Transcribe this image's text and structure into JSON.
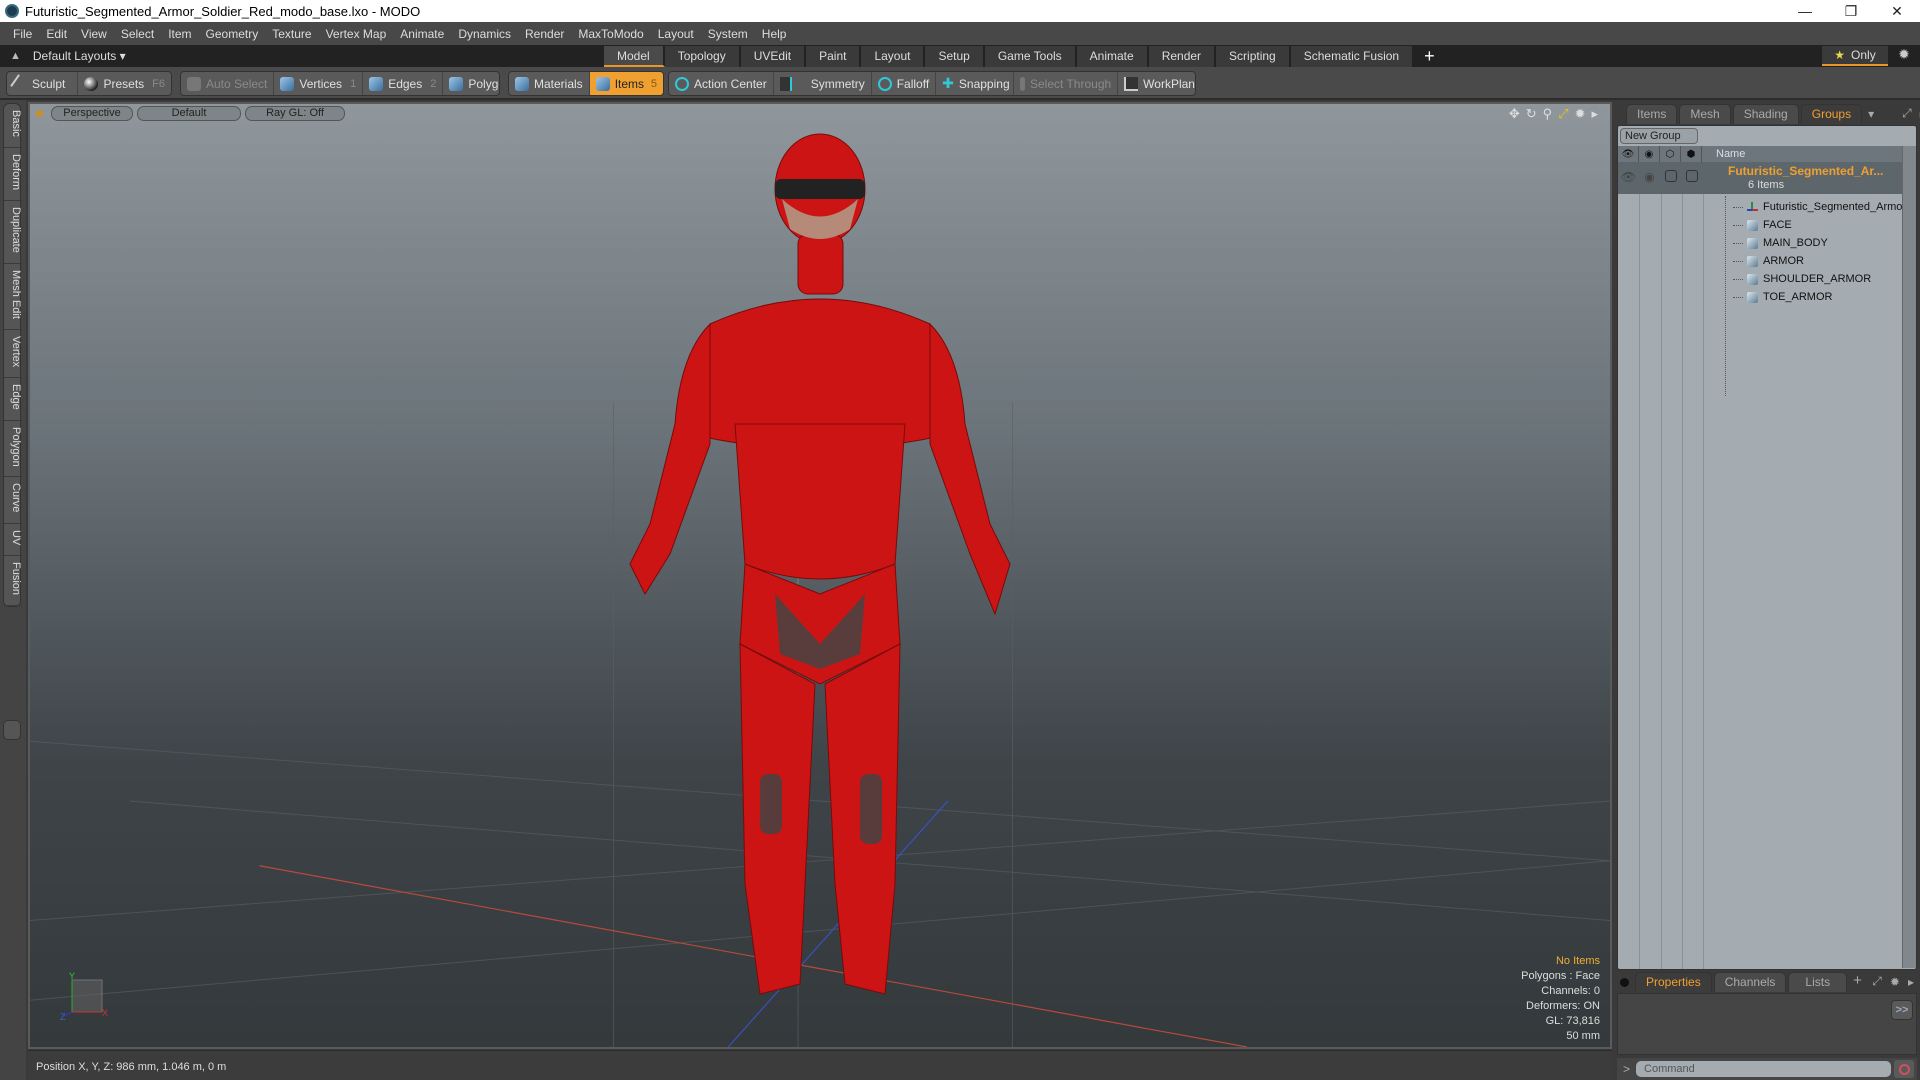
{
  "window": {
    "title": "Futuristic_Segmented_Armor_Soldier_Red_modo_base.lxo - MODO",
    "controls": {
      "minimize": "—",
      "maximize": "❐",
      "close": "✕"
    }
  },
  "menu": [
    "File",
    "Edit",
    "View",
    "Select",
    "Item",
    "Geometry",
    "Texture",
    "Vertex Map",
    "Animate",
    "Dynamics",
    "Render",
    "MaxToModo",
    "Layout",
    "System",
    "Help"
  ],
  "layoutbar": {
    "layouts_label": "Default Layouts ▾",
    "tabs": [
      "Model",
      "Topology",
      "UVEdit",
      "Paint",
      "Layout",
      "Setup",
      "Game Tools",
      "Animate",
      "Render",
      "Scripting",
      "Schematic Fusion"
    ],
    "active_tab": "Model",
    "add_tab": "+",
    "only_label": "Only"
  },
  "toolbar": {
    "sculpt": "Sculpt",
    "presets": "Presets",
    "presets_key": "F6",
    "auto_select": "Auto Select",
    "vertices": "Vertices",
    "vertices_key": "1",
    "edges": "Edges",
    "edges_key": "2",
    "polygons": "Polygons",
    "materials": "Materials",
    "items": "Items",
    "items_key": "5",
    "action_center": "Action Center",
    "symmetry": "Symmetry",
    "falloff": "Falloff",
    "snapping": "Snapping",
    "select_through": "Select Through",
    "workplane": "WorkPlane"
  },
  "left_tabs": [
    "Basic",
    "Deform",
    "Duplicate",
    "Mesh Edit",
    "Vertex",
    "Edge",
    "Polygon",
    "Curve",
    "UV",
    "Fusion"
  ],
  "viewport": {
    "view": "Perspective",
    "shading": "Default",
    "raygl": "Ray GL: Off",
    "stats": {
      "selection": "No Items",
      "polygons": "Polygons : Face",
      "channels": "Channels: 0",
      "deformers": "Deformers: ON",
      "gl": "GL: 73,816",
      "scale": "50 mm"
    },
    "axis": {
      "x": "X",
      "y": "Y",
      "z": "Z"
    },
    "colors": {
      "suit": "#d01010",
      "accent": "#f0a030"
    }
  },
  "statusbar": {
    "position": "Position X, Y, Z:   986 mm, 1.046 m, 0 m"
  },
  "right_panel": {
    "tabs": [
      "Items",
      "Mesh ...",
      "Shading",
      "Groups"
    ],
    "active_tab": "Groups",
    "new_group": "New Group",
    "name_header": "Name",
    "group": {
      "name": "Futuristic_Segmented_Ar...",
      "count": "6 Items",
      "items": [
        "Futuristic_Segmented_Armo...",
        "FACE",
        "MAIN_BODY",
        "ARMOR",
        "SHOULDER_ARMOR",
        "TOE_ARMOR"
      ]
    },
    "bottom_tabs": [
      "Properties",
      "Channels",
      "Lists"
    ],
    "bottom_active": "Properties",
    "more_button": ">>",
    "command_placeholder": "Command",
    "prompt": ">"
  }
}
